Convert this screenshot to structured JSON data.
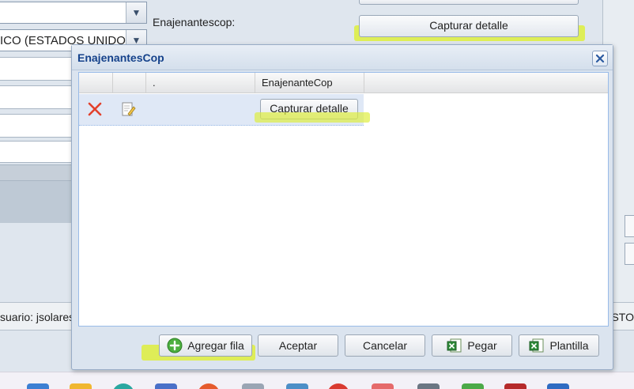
{
  "background": {
    "select_1": {
      "value": ""
    },
    "select_2": {
      "value": "ICO (ESTADOS UNIDOS)"
    },
    "enajenantes_label": "Enajenantescop:",
    "top_button_label": "Capturar detalle",
    "status_user": "suario: jsolares",
    "status_right": "STO"
  },
  "dialog": {
    "title": "EnajenantesCop",
    "grid": {
      "columns": [
        "",
        "",
        ".",
        "EnajenanteCop"
      ],
      "rows": [
        {
          "action_label": "Capturar detalle"
        }
      ]
    },
    "buttons": {
      "add_row": "Agregar fila",
      "accept": "Aceptar",
      "cancel": "Cancelar",
      "paste": "Pegar",
      "template": "Plantilla"
    }
  },
  "colors": {
    "title": "#15428b",
    "highlight": "#deee3c",
    "selected_row": "#dfe8f6",
    "grid_border": "#99bbe8"
  }
}
